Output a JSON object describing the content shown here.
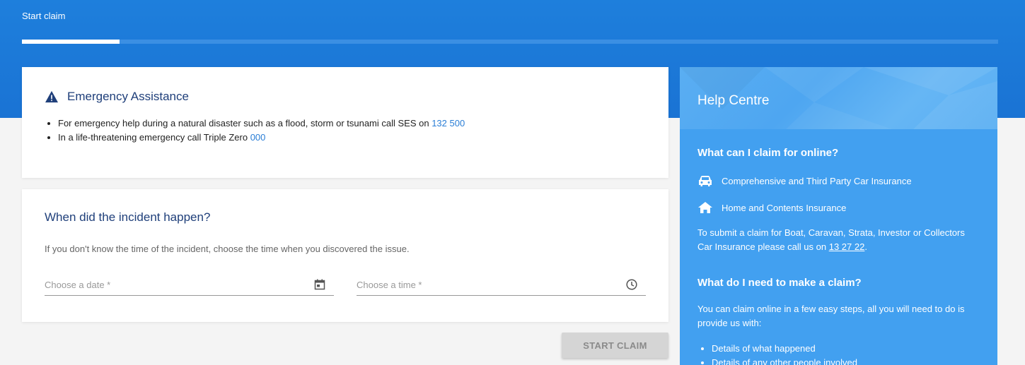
{
  "header": {
    "title": "Start claim",
    "progress_fraction": 0.1
  },
  "emergency": {
    "title": "Emergency Assistance",
    "items": [
      {
        "text": "For emergency help during a natural disaster such as a flood, storm or tsunami call SES on ",
        "link": "132 500"
      },
      {
        "text": "In a life-threatening emergency call Triple Zero ",
        "link": "000"
      }
    ]
  },
  "incident": {
    "title": "When did the incident happen?",
    "hint": "If you don't know the time of the incident, choose the time when you discovered the issue.",
    "date_placeholder": "Choose a date *",
    "time_placeholder": "Choose a time *"
  },
  "actions": {
    "start_label": "START CLAIM"
  },
  "help": {
    "title": "Help Centre",
    "q1": "What can I claim for online?",
    "car": "Comprehensive and Third Party Car Insurance",
    "home": "Home and Contents Insurance",
    "submit_text": "To submit a claim for Boat, Caravan, Strata, Investor or Collectors Car Insurance please call us on ",
    "submit_phone": "13 27 22",
    "submit_end": ".",
    "q2": "What do I need to make a claim?",
    "need_text": "You can claim online in a few easy steps, all you will need to do is provide us with:",
    "list": [
      "Details of what happened",
      "Details of any other people involved"
    ]
  },
  "colors": {
    "brand_blue": "#1a73d4",
    "help_blue": "#42a0f0",
    "heading_navy": "#1f3f7a",
    "link_blue": "#2a7ed6"
  },
  "icons": {
    "warning": "warning-icon",
    "calendar": "calendar-icon",
    "clock": "clock-icon",
    "car": "car-icon",
    "home": "home-icon"
  }
}
